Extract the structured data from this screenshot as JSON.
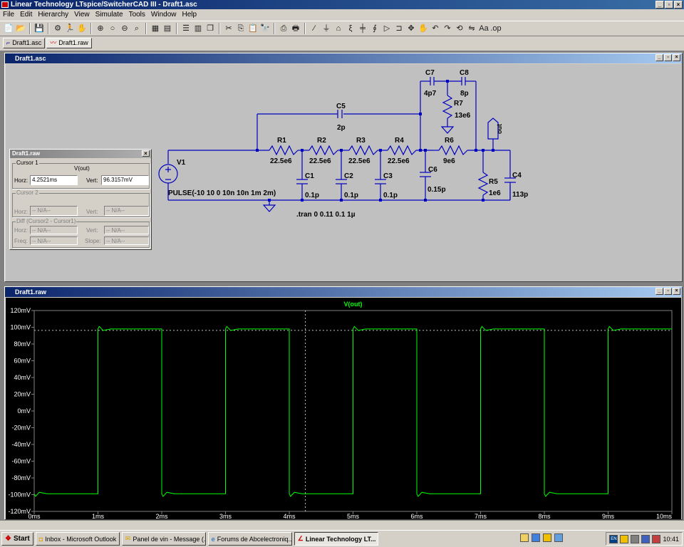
{
  "window": {
    "title": "Linear Technology LTspice/SwitcherCAD III - Draft1.asc",
    "controls": [
      "_",
      "▫",
      "×"
    ]
  },
  "menu": [
    "File",
    "Edit",
    "Hierarchy",
    "View",
    "Simulate",
    "Tools",
    "Window",
    "Help"
  ],
  "toolbar_icons": [
    "new-schematic",
    "open",
    "save",
    "control-panel",
    "run",
    "halt",
    "zoom-in",
    "pan",
    "zoom-out",
    "zoom-fit",
    "autorange",
    "waveform",
    "tile-horizontal",
    "tile-vertical",
    "cascade",
    "cut",
    "copy",
    "paste",
    "find",
    "print-setup",
    "print",
    "wire",
    "ground",
    "label",
    "resistor",
    "capacitor",
    "inductor",
    "diode",
    "component",
    "move",
    "drag",
    "undo",
    "redo",
    "rotate",
    "mirror",
    "text",
    "spice-directive"
  ],
  "tabs": [
    {
      "label": "Draft1.asc",
      "icon": "schematic-icon"
    },
    {
      "label": "Draft1.raw",
      "icon": "waveform-icon"
    }
  ],
  "schematic": {
    "title": "Draft1.asc",
    "parts": {
      "V1": "V1",
      "pulse": "PULSE(-10 10 0 10n 10n 1m 2m)",
      "R1": "R1",
      "R1v": "22.5e6",
      "R2": "R2",
      "R2v": "22.5e6",
      "R3": "R3",
      "R3v": "22.5e6",
      "R4": "R4",
      "R4v": "22.5e6",
      "R5": "R5",
      "R5v": "1e6",
      "R6": "R6",
      "R6v": "9e6",
      "R7": "R7",
      "R7v": "13e6",
      "C1": "C1",
      "C1v": "0.1p",
      "C2": "C2",
      "C2v": "0.1p",
      "C3": "C3",
      "C3v": "0.1p",
      "C4": "C4",
      "C4v": "113p",
      "C5": "C5",
      "C5v": "2p",
      "C6": "C6",
      "C6v": "0.15p",
      "C7": "C7",
      "C7v": "4p7",
      "C8": "C8",
      "C8v": "8p",
      "out": "out",
      "tran": ".tran 0 0.11 0.1 1µ"
    }
  },
  "cursor_window": {
    "title": "Draft1.raw",
    "close": "×",
    "cursor1_label": "Cursor 1",
    "trace": "V(out)",
    "horz_label": "Horz:",
    "horz_value": "4.2521ms",
    "vert_label": "Vert:",
    "vert_value": "96.3157mV",
    "cursor2_label": "Cursor 2",
    "na": "-- N/A--",
    "diff_label": "Diff (Cursor2 - Cursor1)",
    "freq_label": "Freq:",
    "slope_label": "Slope:"
  },
  "waveform": {
    "title": "Draft1.raw",
    "trace_label": "V(out)"
  },
  "chart_data": {
    "type": "line",
    "series": [
      {
        "name": "V(out)",
        "color": "#00ff00"
      }
    ],
    "x_unit": "ms",
    "y_unit": "mV",
    "xlim": [
      0,
      10
    ],
    "ylim": [
      -120,
      120
    ],
    "x_ticks": [
      "0ms",
      "1ms",
      "2ms",
      "3ms",
      "4ms",
      "5ms",
      "6ms",
      "7ms",
      "8ms",
      "9ms",
      "10ms"
    ],
    "y_ticks": [
      "120mV",
      "100mV",
      "80mV",
      "60mV",
      "40mV",
      "20mV",
      "0mV",
      "-20mV",
      "-40mV",
      "-60mV",
      "-80mV",
      "-100mV",
      "-120mV"
    ],
    "square_wave": {
      "high_mV": 98,
      "low_mV": -99,
      "period_ms": 2,
      "high_ms": 1,
      "overshoot_mV": 3,
      "start_high": false
    },
    "cursor_x_ms": 4.2521,
    "cursor_y_mV": 96.3157,
    "grid": false
  },
  "taskbar": {
    "start": "Start",
    "tasks": [
      {
        "label": "Inbox - Microsoft Outlook",
        "active": false
      },
      {
        "label": "Panel de vin - Message (...",
        "active": false
      },
      {
        "label": "Forums de Abcelectroniq...",
        "active": false
      },
      {
        "label": "Linear Technology LT...",
        "active": true
      }
    ],
    "lang": "EN",
    "clock": "10:41"
  }
}
